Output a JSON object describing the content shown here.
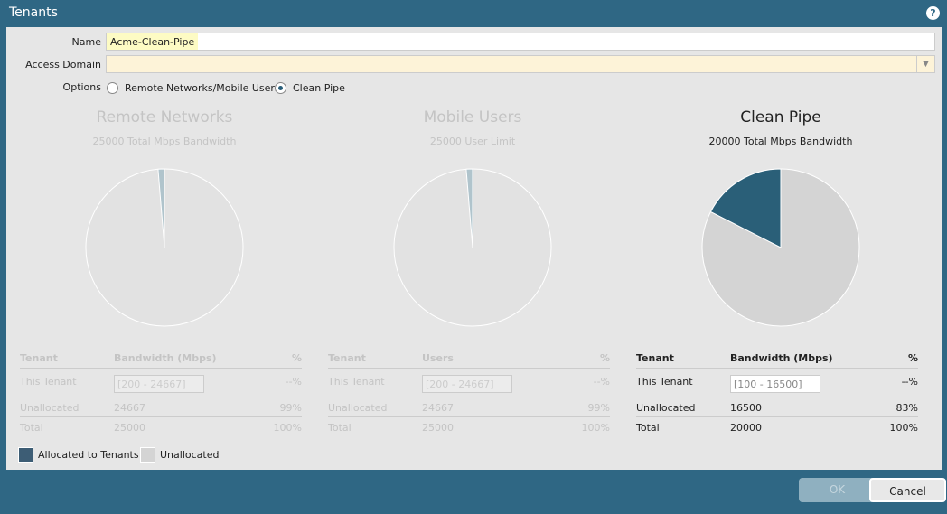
{
  "window": {
    "title": "Tenants",
    "help_icon": "?"
  },
  "form": {
    "name_label": "Name",
    "name_value": "Acme-Clean-Pipe",
    "access_domain_label": "Access Domain",
    "access_domain_value": "",
    "options_label": "Options",
    "option1": "Remote Networks/Mobile Users",
    "option2": "Clean Pipe",
    "selected": "Clean Pipe"
  },
  "colors": {
    "allocated": "#2a5f78",
    "unallocated": "#d4d4d4",
    "disabled_allocated": "#b0c4cc",
    "disabled_unallocated": "#e2e2e2"
  },
  "panels": [
    {
      "title": "Remote Networks",
      "subtitle": "25000 Total Mbps Bandwidth",
      "enabled": false,
      "allocated_fraction": 0.013,
      "col1": "Tenant",
      "col2": "Bandwidth (Mbps)",
      "col3": "%",
      "this_label": "This Tenant",
      "this_placeholder": "[200 - 24667]",
      "this_pct": "--%",
      "unalloc_label": "Unallocated",
      "unalloc_value": "24667",
      "unalloc_pct": "99%",
      "total_label": "Total",
      "total_value": "25000",
      "total_pct": "100%"
    },
    {
      "title": "Mobile Users",
      "subtitle": "25000 User Limit",
      "enabled": false,
      "allocated_fraction": 0.013,
      "col1": "Tenant",
      "col2": "Users",
      "col3": "%",
      "this_label": "This Tenant",
      "this_placeholder": "[200 - 24667]",
      "this_pct": "--%",
      "unalloc_label": "Unallocated",
      "unalloc_value": "24667",
      "unalloc_pct": "99%",
      "total_label": "Total",
      "total_value": "25000",
      "total_pct": "100%"
    },
    {
      "title": "Clean Pipe",
      "subtitle": "20000 Total Mbps Bandwidth",
      "enabled": true,
      "allocated_fraction": 0.175,
      "col1": "Tenant",
      "col2": "Bandwidth (Mbps)",
      "col3": "%",
      "this_label": "This Tenant",
      "this_placeholder": "[100 - 16500]",
      "this_pct": "--%",
      "unalloc_label": "Unallocated",
      "unalloc_value": "16500",
      "unalloc_pct": "83%",
      "total_label": "Total",
      "total_value": "20000",
      "total_pct": "100%"
    }
  ],
  "legend": {
    "allocated": "Allocated to Tenants",
    "unallocated": "Unallocated"
  },
  "buttons": {
    "ok": "OK",
    "cancel": "Cancel"
  }
}
